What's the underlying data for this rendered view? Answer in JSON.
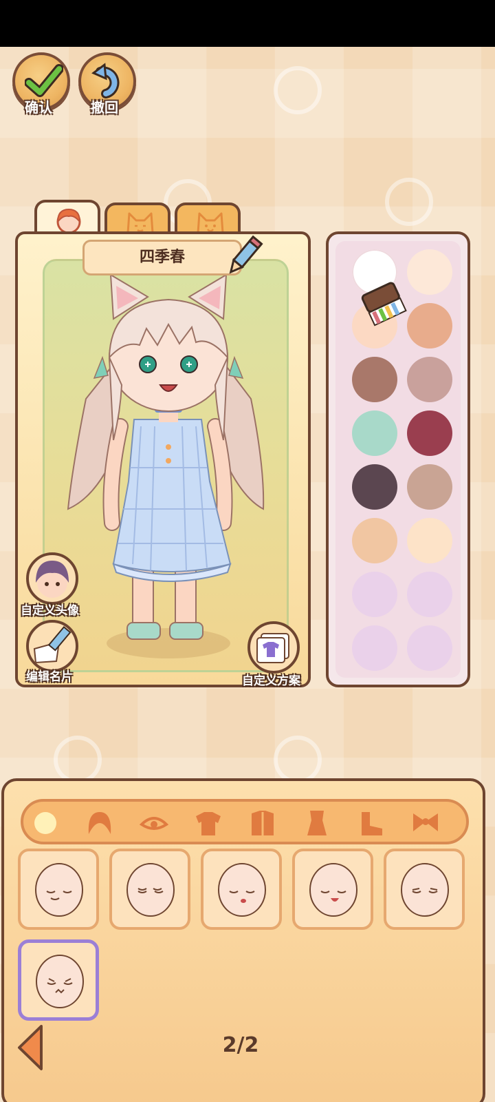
{
  "toolbar": {
    "confirm_label": "确认",
    "undo_label": "撤回"
  },
  "tabs": [
    {
      "icon": "face-icon",
      "active": true
    },
    {
      "icon": "cat-face-icon",
      "active": false
    },
    {
      "icon": "cat-smile-icon",
      "active": false
    }
  ],
  "character": {
    "name": "四季春",
    "custom_avatar_label": "自定义头像",
    "edit_card_label": "编辑名片",
    "custom_scheme_label": "自定义方案"
  },
  "palette": {
    "colors": [
      "#ffffff",
      "#fde8d8",
      "#fcd9c3",
      "#e8ac8c",
      "#a9786a",
      "#c9a19c",
      "#a8d9c9",
      "#9a3e4f",
      "#5b4650",
      "#c9a494",
      "#f1c6a2",
      "#fde3c8",
      "#ead1ea",
      "#ead1ea",
      "#ead1ea",
      "#ead1ea"
    ],
    "selected_index": 2
  },
  "categories": [
    "body-icon",
    "hair-icon",
    "eye-icon",
    "top-icon",
    "coat-icon",
    "dress-icon",
    "shoe-icon",
    "bow-icon"
  ],
  "items": {
    "selected_index": 5,
    "count": 6
  },
  "pagination": {
    "text": "2/2"
  },
  "colors": {
    "outline": "#6e4530",
    "panel": "#f7c98f",
    "accent_select": "#9b7fd6"
  }
}
